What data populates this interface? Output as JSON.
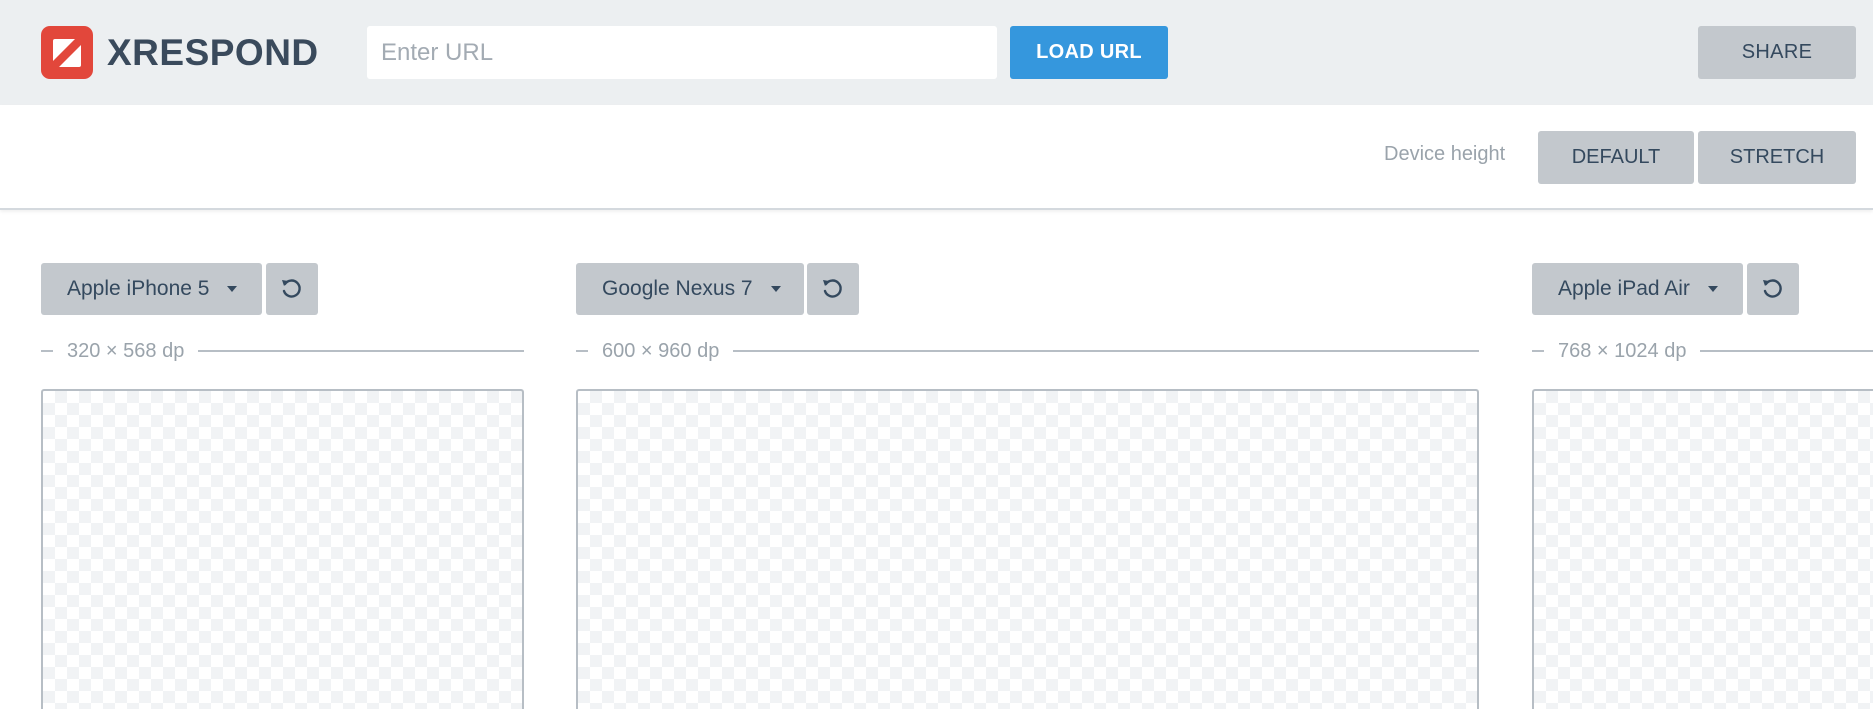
{
  "app": {
    "brand": "XRESPOND",
    "brand_color": "#e2473b",
    "logo_icon": "xrespond-logo-icon"
  },
  "topbar": {
    "url_placeholder": "Enter URL",
    "url_value": "",
    "load_label": "LOAD URL",
    "load_color": "#3597dd",
    "share_label": "SHARE"
  },
  "subbar": {
    "device_height_label": "Device height",
    "default_label": "DEFAULT",
    "stretch_label": "STRETCH"
  },
  "devices": [
    {
      "name": "Apple iPhone 5",
      "dims": "320 × 568 dp",
      "rotate_icon": "rotate-icon"
    },
    {
      "name": "Google Nexus 7",
      "dims": "600 × 960 dp",
      "rotate_icon": "rotate-icon"
    },
    {
      "name": "Apple iPad Air",
      "dims": "768 × 1024 dp",
      "rotate_icon": "rotate-icon"
    }
  ]
}
